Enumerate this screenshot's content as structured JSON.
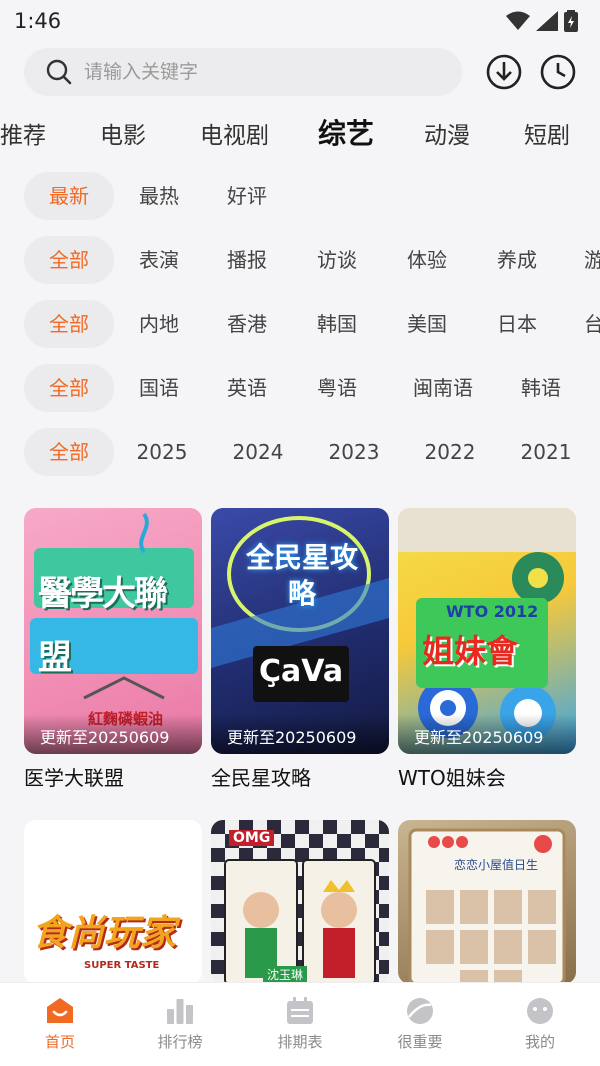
{
  "status_bar": {
    "time": "1:46"
  },
  "search": {
    "placeholder": "请输入关键字"
  },
  "tabs": [
    {
      "label": "推荐"
    },
    {
      "label": "电影"
    },
    {
      "label": "电视剧"
    },
    {
      "label": "综艺",
      "active": true
    },
    {
      "label": "动漫"
    },
    {
      "label": "短剧"
    }
  ],
  "filters": {
    "sort": [
      "最新",
      "最热",
      "好评"
    ],
    "type": [
      "全部",
      "表演",
      "播报",
      "访谈",
      "体验",
      "养成",
      "游"
    ],
    "region": [
      "全部",
      "内地",
      "香港",
      "韩国",
      "美国",
      "日本",
      "台"
    ],
    "language": [
      "全部",
      "国语",
      "英语",
      "粤语",
      "闽南语",
      "韩语"
    ],
    "year": [
      "全部",
      "2025",
      "2024",
      "2023",
      "2022",
      "2021"
    ]
  },
  "cards": [
    {
      "title": "医学大联盟",
      "update": "更新至20250609",
      "poster_text": "醫學大聯盟",
      "poster_sub": "紅麴磷蝦油",
      "poster_colors": [
        "#f28fb5",
        "#5ec7e8"
      ]
    },
    {
      "title": "全民星攻略",
      "update": "更新至20250609",
      "poster_text": "全民星攻略",
      "poster_sub": "ÇaVa",
      "poster_colors": [
        "#2a3a8a",
        "#1a1f4a"
      ]
    },
    {
      "title": "WTO姐妹会",
      "update": "更新至20250609",
      "poster_text": "姐妹會",
      "poster_sub": "WTO 2012",
      "poster_colors": [
        "#f7c93a",
        "#3aa4e8"
      ]
    },
    {
      "title": "",
      "update": "",
      "poster_text": "食尚玩家",
      "poster_sub": "SUPER TASTE",
      "poster_colors": [
        "#ffffff",
        "#f7f0e8"
      ]
    },
    {
      "title": "",
      "update": "",
      "poster_text": "OMG",
      "poster_sub": "沈玉琳",
      "poster_colors": [
        "#e8e8e8",
        "#9aa0b0"
      ]
    },
    {
      "title": "",
      "update": "",
      "poster_text": "恋恋小屋值日生",
      "poster_sub": "",
      "poster_colors": [
        "#d9c7a8",
        "#8a6e4a"
      ]
    }
  ],
  "bottom_nav": [
    {
      "label": "首页",
      "active": true
    },
    {
      "label": "排行榜"
    },
    {
      "label": "排期表"
    },
    {
      "label": "很重要"
    },
    {
      "label": "我的"
    }
  ],
  "colors": {
    "accent": "#f06a24",
    "chip_bg": "#ebebee"
  },
  "icons": [
    "search-icon",
    "download-icon",
    "history-icon",
    "home-icon",
    "ranking-icon",
    "calendar-icon",
    "planet-icon",
    "profile-icon"
  ]
}
